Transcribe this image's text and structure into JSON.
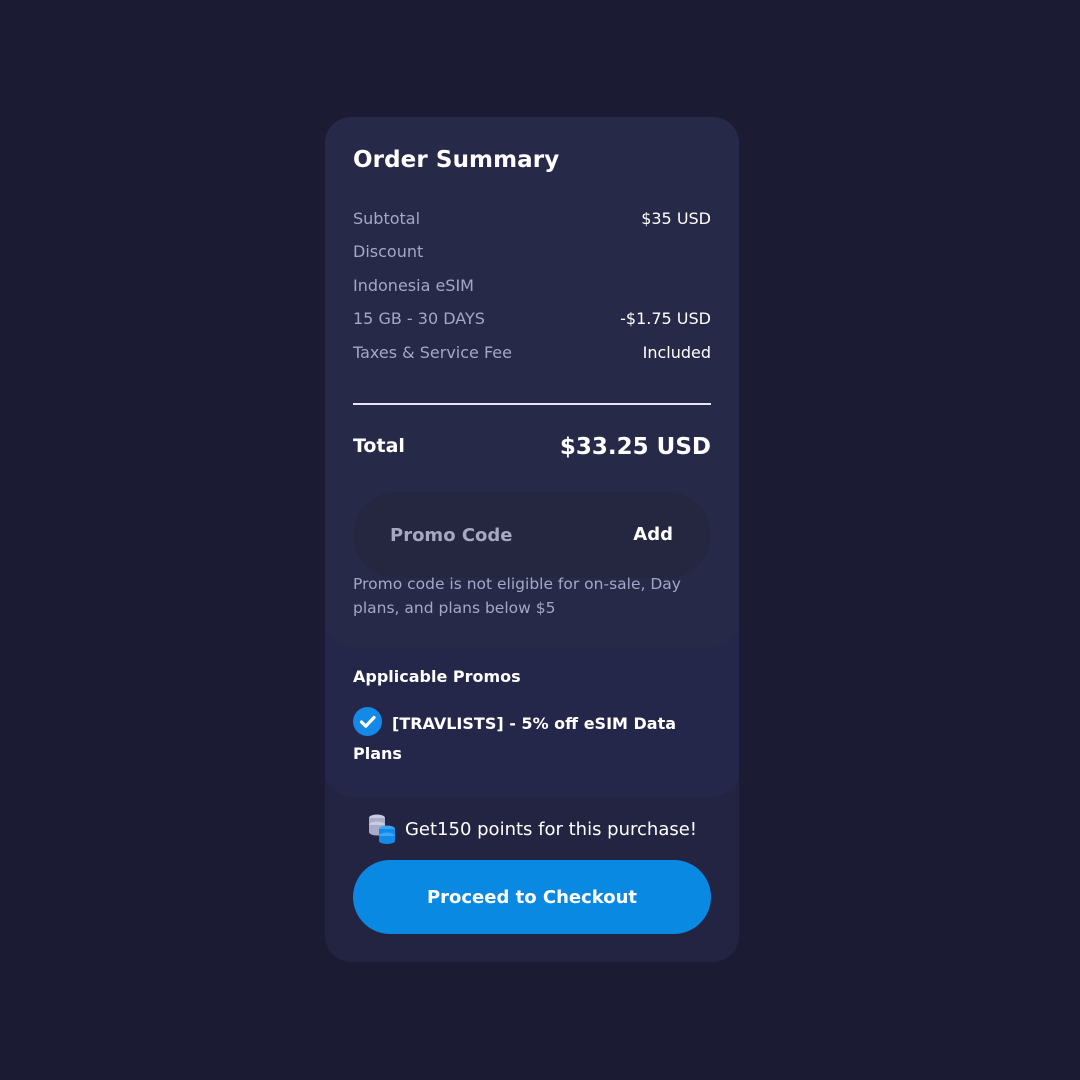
{
  "order_summary": {
    "title": "Order Summary",
    "rows": [
      {
        "label": "Subtotal",
        "value": "$35 USD"
      },
      {
        "label": "Discount",
        "value": ""
      },
      {
        "label": "Indonesia eSIM",
        "value": ""
      },
      {
        "label": "15 GB - 30 DAYS",
        "value": "-$1.75 USD"
      },
      {
        "label": "Taxes & Service Fee",
        "value": "Included"
      }
    ],
    "total_label": "Total",
    "total_value": "$33.25 USD"
  },
  "promo": {
    "placeholder": "Promo Code",
    "add_label": "Add",
    "note": "Promo code is not eligible for on-sale, Day plans, and plans below $5"
  },
  "applicable_promos": {
    "title": "Applicable Promos",
    "items": [
      {
        "label": "[TRAVLISTS] - 5% off eSIM Data Plans",
        "checked": true
      }
    ]
  },
  "points": {
    "text": "Get150 points for this purchase!",
    "icon": "coins-icon"
  },
  "checkout": {
    "label": "Proceed to Checkout"
  },
  "colors": {
    "background": "#1b1b33",
    "card": "#272949",
    "accent": "#0a89e3",
    "muted_text": "#a5a8c2"
  }
}
